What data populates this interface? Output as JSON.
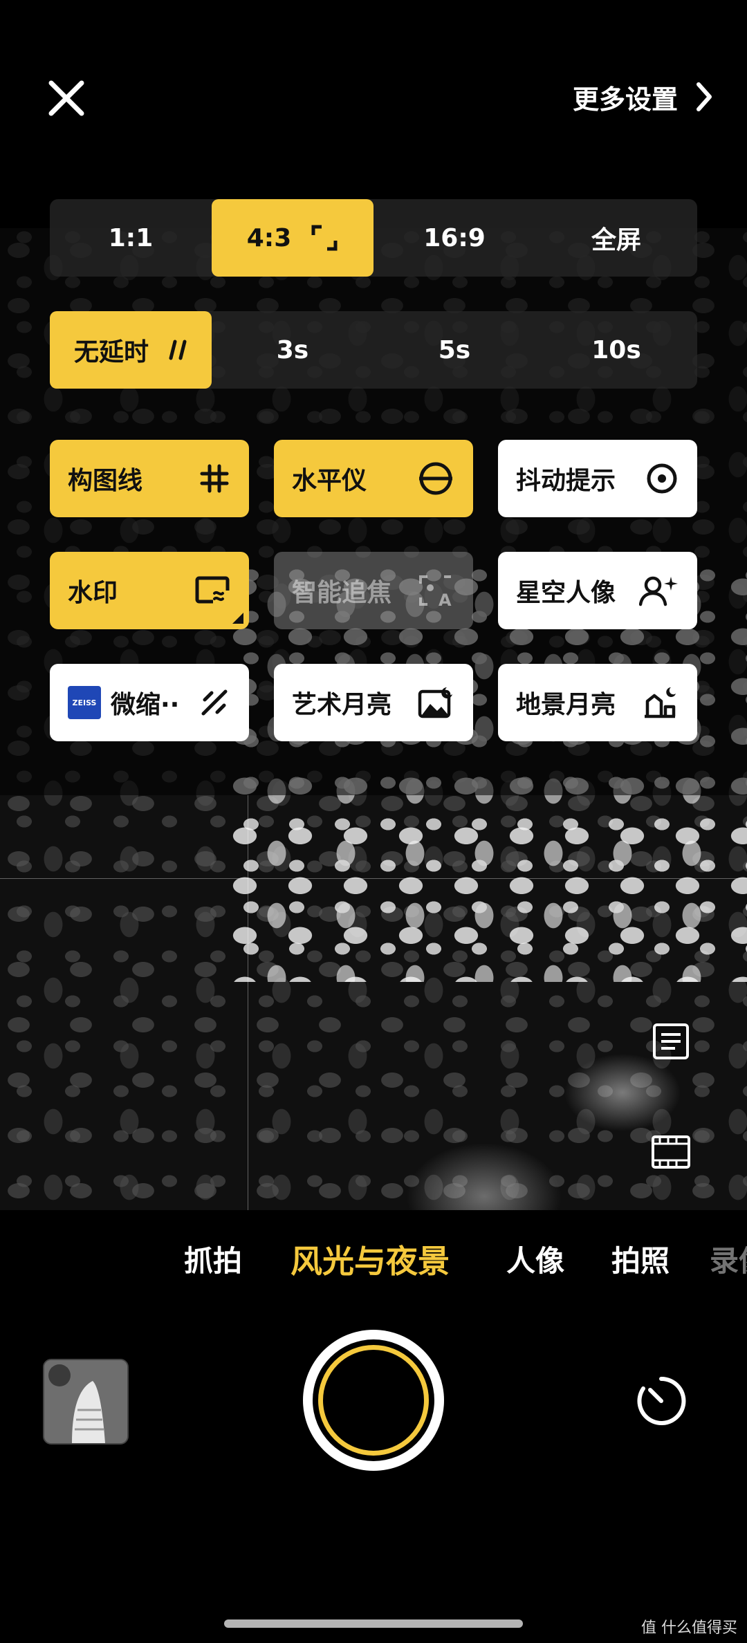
{
  "header": {
    "more_settings": "更多设置"
  },
  "aspect_ratio": {
    "options": [
      "1:1",
      "4:3",
      "16:9",
      "全屏"
    ],
    "selected": "4:3"
  },
  "timer": {
    "options": [
      "无延时",
      "3s",
      "5s",
      "10s"
    ],
    "selected": "无延时"
  },
  "features": [
    {
      "label": "构图线",
      "icon": "grid-icon",
      "state": "on"
    },
    {
      "label": "水平仪",
      "icon": "level-icon",
      "state": "on"
    },
    {
      "label": "抖动提示",
      "icon": "target-icon",
      "state": "off"
    },
    {
      "label": "水印",
      "icon": "watermark-icon",
      "state": "on"
    },
    {
      "label": "智能追焦",
      "icon": "auto-focus-icon",
      "state": "disabled"
    },
    {
      "label": "星空人像",
      "icon": "star-portrait-icon",
      "state": "off"
    },
    {
      "label": "微缩··",
      "badge": "ZEISS",
      "icon": "tilt-shift-icon",
      "state": "off"
    },
    {
      "label": "艺术月亮",
      "icon": "moon-art-icon",
      "state": "off"
    },
    {
      "label": "地景月亮",
      "icon": "landscape-moon-icon",
      "state": "off"
    }
  ],
  "modes": [
    "抓拍",
    "风光与夜景",
    "人像",
    "拍照",
    "录像"
  ],
  "active_mode": "风光与夜景",
  "watermark": "值 什么值得买",
  "colors": {
    "accent": "#f5c93d",
    "background": "#000000"
  }
}
